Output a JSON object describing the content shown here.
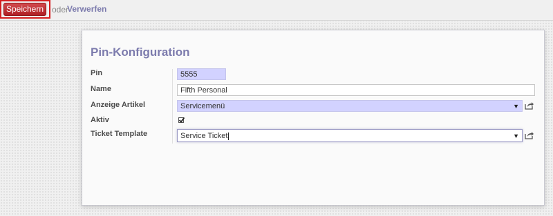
{
  "toolbar": {
    "save_label": "Speichern",
    "or_label": "oder",
    "discard_label": "Verwerfen"
  },
  "form": {
    "title": "Pin-Konfiguration",
    "fields": {
      "pin": {
        "label": "Pin",
        "value": "5555"
      },
      "name": {
        "label": "Name",
        "value": "Fifth Personal"
      },
      "anzeige_artikel": {
        "label": "Anzeige Artikel",
        "value": "Servicemenü"
      },
      "aktiv": {
        "label": "Aktiv",
        "checked": true
      },
      "ticket_template": {
        "label": "Ticket Template",
        "value": "Service Ticket"
      }
    }
  },
  "icons": {
    "dropdown": "chevron-down-icon",
    "external": "external-link-icon",
    "checkmark": "checkmark-icon"
  },
  "colors": {
    "primary_button": "#c02a2e",
    "highlight_border": "#d51e20",
    "accent": "#7c7bad",
    "required_field_bg": "#d2d2ff"
  }
}
